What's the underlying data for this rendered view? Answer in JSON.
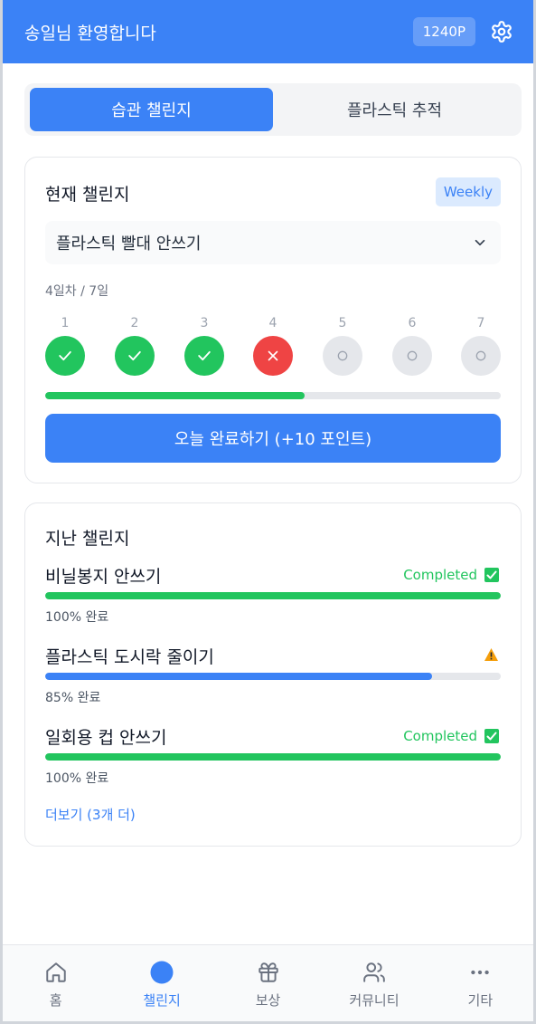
{
  "header": {
    "title": "송일님 환영합니다",
    "points": "1240P",
    "settings_icon": "gear-icon"
  },
  "tabs": [
    {
      "label": "습관 챌린지",
      "active": true
    },
    {
      "label": "플라스틱 추적",
      "active": false
    }
  ],
  "current": {
    "title": "현재 챌린지",
    "badge": "Weekly",
    "selected": "플라스틱 빨대 안쓰기",
    "day_label": "4일차 / 7일",
    "days": [
      {
        "num": "1",
        "state": "done"
      },
      {
        "num": "2",
        "state": "done"
      },
      {
        "num": "3",
        "state": "done"
      },
      {
        "num": "4",
        "state": "fail"
      },
      {
        "num": "5",
        "state": "todo"
      },
      {
        "num": "6",
        "state": "todo"
      },
      {
        "num": "7",
        "state": "todo"
      }
    ],
    "progress": 0.57,
    "button": "오늘 완료하기 (+10 포인트)"
  },
  "past": {
    "title": "지난 챌린지",
    "items": [
      {
        "name": "비닐봉지 안쓰기",
        "status": "Completed",
        "status_icon": "check-box-icon",
        "progress": 1.0,
        "pct_label": "100% 완료",
        "color": "#22c55e"
      },
      {
        "name": "플라스틱 도시락 줄이기",
        "status": "",
        "status_icon": "warning-icon",
        "progress": 0.85,
        "pct_label": "85% 완료",
        "color": "#3b82f6"
      },
      {
        "name": "일회용 컵 안쓰기",
        "status": "Completed",
        "status_icon": "check-box-icon",
        "progress": 1.0,
        "pct_label": "100% 완료",
        "color": "#22c55e"
      }
    ],
    "more": "더보기 (3개 더)"
  },
  "nav": [
    {
      "label": "홈",
      "icon": "home-icon",
      "active": false
    },
    {
      "label": "챌린지",
      "icon": "circle-icon",
      "active": true
    },
    {
      "label": "보상",
      "icon": "gift-icon",
      "active": false
    },
    {
      "label": "커뮤니티",
      "icon": "users-icon",
      "active": false
    },
    {
      "label": "기타",
      "icon": "more-icon",
      "active": false
    }
  ],
  "colors": {
    "primary": "#3b82f6",
    "success": "#22c55e",
    "danger": "#ef4444",
    "warning": "#f59e0b"
  }
}
